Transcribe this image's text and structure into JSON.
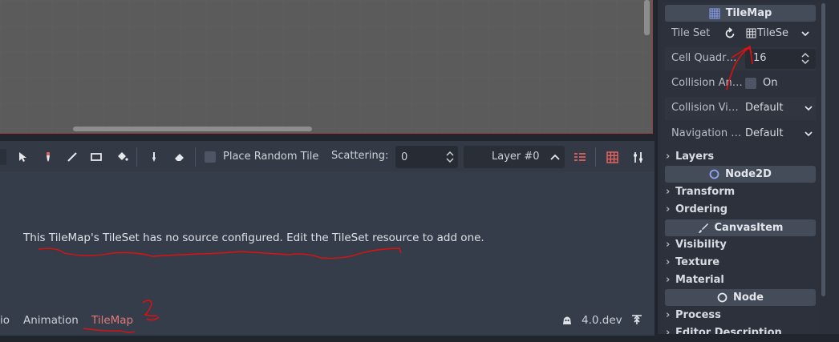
{
  "viewport": {
    "label": ""
  },
  "toolbar": {
    "place_random_tile": "Place Random Tile",
    "scattering_label": "Scattering:",
    "scattering_value": "0",
    "layer_value": "Layer #0"
  },
  "message": "This TileMap's TileSet has no source configured. Edit the TileSet resource to add one.",
  "bottom_tabs": {
    "partial": "io",
    "animation": "Animation",
    "tilemap": "TileMap",
    "version": "4.0.dev"
  },
  "annotations": {
    "mark1": "1",
    "mark2": "2"
  },
  "inspector": {
    "header_tilemap": "TileMap",
    "tile_set_label": "Tile Set",
    "tile_set_value": "TileSe",
    "cell_quadrant_label": "Cell Quadr…",
    "cell_quadrant_value": "16",
    "collision_an_label": "Collision An…",
    "collision_an_value": "On",
    "collision_vi_label": "Collision Vi…",
    "collision_vi_value": "Default",
    "navigation_label": "Navigation …",
    "navigation_value": "Default",
    "layers": "Layers",
    "header_node2d": "Node2D",
    "transform": "Transform",
    "ordering": "Ordering",
    "header_canvasitem": "CanvasItem",
    "visibility": "Visibility",
    "texture": "Texture",
    "material": "Material",
    "header_node": "Node",
    "process": "Process",
    "editor_description": "Editor Description"
  },
  "colors": {
    "accent_red": "#e0625f",
    "annotation_red": "#e01010",
    "active_tab": "#e07b79"
  }
}
